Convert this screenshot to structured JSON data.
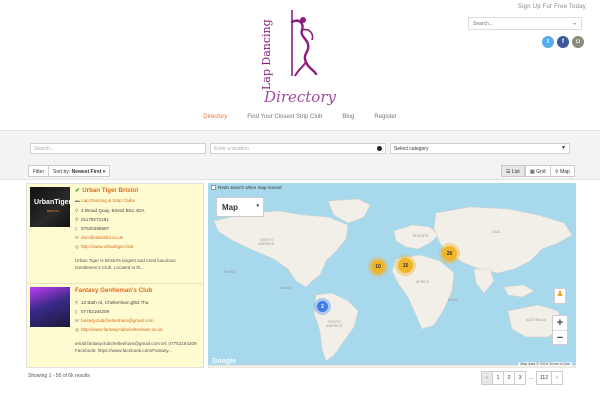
{
  "header": {
    "signup": "Sign Up For Free Today",
    "search_placeholder": "Search...",
    "logo": {
      "line1": "Lap Dancing",
      "line2": "Directory"
    },
    "social": [
      {
        "name": "twitter",
        "glyph": "t"
      },
      {
        "name": "facebook",
        "glyph": "f"
      },
      {
        "name": "instagram",
        "glyph": "◘"
      }
    ]
  },
  "nav": [
    {
      "label": "Directory",
      "active": true
    },
    {
      "label": "Find Your Closest Strip Club",
      "active": false
    },
    {
      "label": "Blog",
      "active": false
    },
    {
      "label": "Register",
      "active": false
    }
  ],
  "filters": {
    "search_placeholder": "Search...",
    "location_placeholder": "Enter a location",
    "category": "Select category",
    "filter_label": "Filter",
    "sort_label": "Sort by:",
    "sort_value": "Newest First",
    "views": {
      "list": "List",
      "grid": "Grid",
      "map": "Map"
    }
  },
  "listings": [
    {
      "title": "Urban Tiger Bristol",
      "verified": true,
      "category": "Lap Dancing & Strip Clubs",
      "address": "4 Broad Quay, Bristol BS1 4DA",
      "phone1": "01179272181",
      "phone2": "07530395597",
      "email": "dom@utbristol.co.uk",
      "website": "http://www.urbantiger.club",
      "description": "Urban Tiger is Bristol's largest and most luxurious Gentlemen's Club. Located in th...",
      "thumb_text": "UrbanTiger",
      "thumb_sub": "BRISTOL"
    },
    {
      "title": "Fantasy Gentleman's Club",
      "address": "12 Bath rd, Cheltenham,gl53 7ha",
      "phone1": "07752164209",
      "email": "fantasyclubcheltenham@gmail.com",
      "website": "http://www.fantasyclubcheltenham.co.uk",
      "description": "email:fantasyclubcheltenham@gmail.com tel: 07752164209 Facebook: https://www.facebook.com/Fantasy..."
    }
  ],
  "map": {
    "redo_label": "Redo search when map moved",
    "type_label": "Map",
    "attribution": "Map data © 2018  Terms of Use",
    "google": "Google",
    "clusters": [
      {
        "count": "10"
      },
      {
        "count": "15"
      },
      {
        "count": "26"
      },
      {
        "count": "2"
      }
    ]
  },
  "footer": {
    "showing": "Showing 1 - 50 of 6k results",
    "pages": [
      "‹",
      "1",
      "2",
      "3",
      "...",
      "112",
      "›"
    ]
  },
  "colors": {
    "accent": "#e06a22",
    "brand": "#8a1d7e",
    "sea": "#a8d8ec",
    "land": "#f1efe8",
    "highlight": "#fffbd0"
  }
}
